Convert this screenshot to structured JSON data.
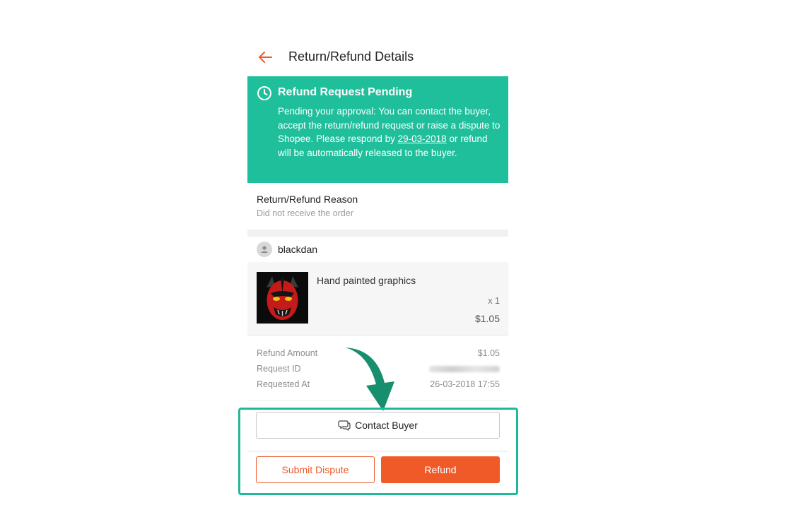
{
  "header": {
    "title": "Return/Refund Details",
    "back_icon": "arrow-left-icon"
  },
  "status": {
    "title": "Refund Request Pending",
    "body_before": "Pending your approval: You can contact the buyer, accept the return/refund request or raise a dispute to Shopee. Please respond by ",
    "deadline": "29-03-2018",
    "body_after": " or refund will be automatically released to the buyer.",
    "icon": "clock-icon",
    "color": "#1fbf9c"
  },
  "reason": {
    "label": "Return/Refund Reason",
    "value": "Did not receive the order"
  },
  "buyer": {
    "name": "blackdan",
    "icon": "user-icon"
  },
  "product": {
    "name": "Hand painted graphics",
    "quantity": "x 1",
    "price": "$1.05"
  },
  "details": {
    "refund_amount_label": "Refund Amount",
    "refund_amount": "$1.05",
    "request_id_label": "Request ID",
    "requested_at_label": "Requested At",
    "requested_at": "26-03-2018 17:55"
  },
  "actions": {
    "contact_buyer": "Contact Buyer",
    "submit_dispute": "Submit Dispute",
    "refund": "Refund",
    "accent_color": "#f05a28"
  },
  "annotation": {
    "highlight_color": "#1fb99a"
  }
}
